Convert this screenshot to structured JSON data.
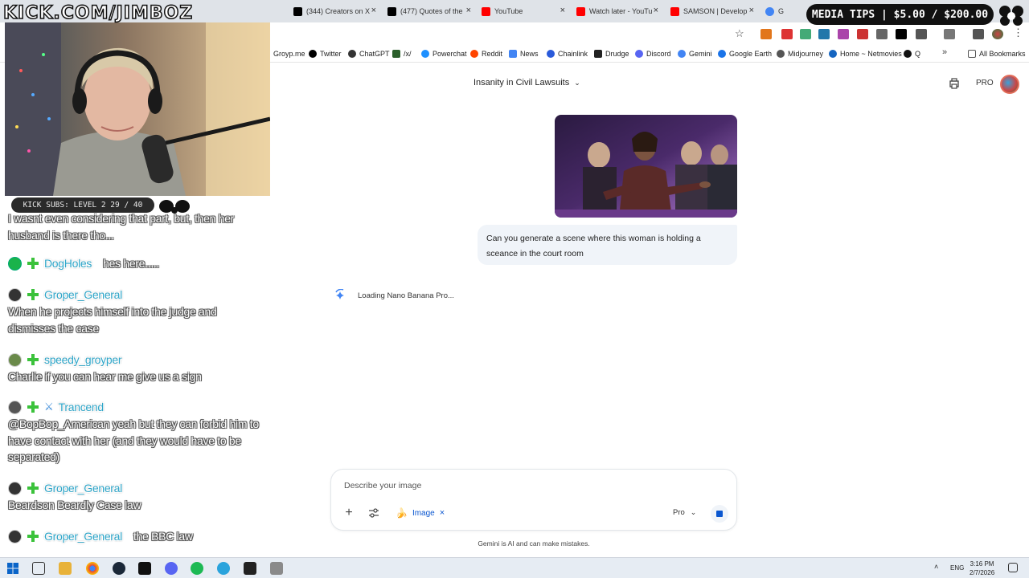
{
  "overlay": {
    "stream_url": "KICK.COM/JIMBOZ",
    "media_tips": "MEDIA TIPS | $5.00 / $200.00",
    "kick_subs": "KICK SUBS: LEVEL 2 29 / 40"
  },
  "browser": {
    "tabs": [
      {
        "title": "(344) Creators on X",
        "icon": "x-logo-icon",
        "color": "#000000"
      },
      {
        "title": "(477) Quotes of the",
        "icon": "x-logo-icon",
        "color": "#000000"
      },
      {
        "title": "YouTube",
        "icon": "youtube-icon",
        "color": "#ff0000"
      },
      {
        "title": "Watch later - YouTu",
        "icon": "youtube-icon",
        "color": "#ff0000"
      },
      {
        "title": "SAMSON | Develop",
        "icon": "youtube-icon",
        "color": "#ff0000"
      },
      {
        "title": "G",
        "icon": "gemini-icon",
        "color": "#4285f4"
      }
    ],
    "bookmarks": [
      {
        "label": "Groyp.me",
        "color": "#888888"
      },
      {
        "label": "Twitter",
        "color": "#000000"
      },
      {
        "label": "ChatGPT",
        "color": "#333333"
      },
      {
        "label": "/x/",
        "color": "#2b5f2b"
      },
      {
        "label": "Powerchat",
        "color": "#1e90ff"
      },
      {
        "label": "Reddit",
        "color": "#ff4500"
      },
      {
        "label": "News",
        "color": "#4285f4"
      },
      {
        "label": "Chainlink",
        "color": "#2a5ada"
      },
      {
        "label": "Drudge",
        "color": "#222222"
      },
      {
        "label": "Discord",
        "color": "#5865f2"
      },
      {
        "label": "Gemini",
        "color": "#4285f4"
      },
      {
        "label": "Google Earth",
        "color": "#1a73e8"
      },
      {
        "label": "Midjourney",
        "color": "#555555"
      },
      {
        "label": "Home ~ Netmovies",
        "color": "#1565c0"
      },
      {
        "label": "Q",
        "color": "#111111"
      }
    ],
    "all_bookmarks": "All Bookmarks"
  },
  "gemini": {
    "chat_title": "Insanity in Civil Lawsuits",
    "pro_badge": "PRO",
    "user_prompt": "Can you generate a scene where this woman is holding a sceance in the court room",
    "loading_text": "Loading Nano Banana Pro...",
    "input_placeholder": "Describe your image",
    "image_chip": "Image",
    "mode": "Pro",
    "disclaimer": "Gemini is AI and can make mistakes."
  },
  "chat": [
    {
      "user": "",
      "text": "I wasnt even considering that part, but, then her husband is there tho..."
    },
    {
      "user": "DogHoles",
      "text": "hes here.....",
      "inline": true
    },
    {
      "user": "Groper_General",
      "text": "When he projects himself into the judge and dismisses the case"
    },
    {
      "user": "speedy_groyper",
      "text": "Charlie if you can hear me give us a sign"
    },
    {
      "user": "Trancend",
      "text": "@BopBop_American yeah but they can forbid him to have contact with her (and they would have to be separated)"
    },
    {
      "user": "Groper_General",
      "text": "Beardson Beardly Case law"
    },
    {
      "user": "Groper_General",
      "text": "the BBC law",
      "inline": true
    }
  ],
  "taskbar": {
    "language": "ENG",
    "time": "3:16 PM",
    "date": "2/7/2026"
  }
}
